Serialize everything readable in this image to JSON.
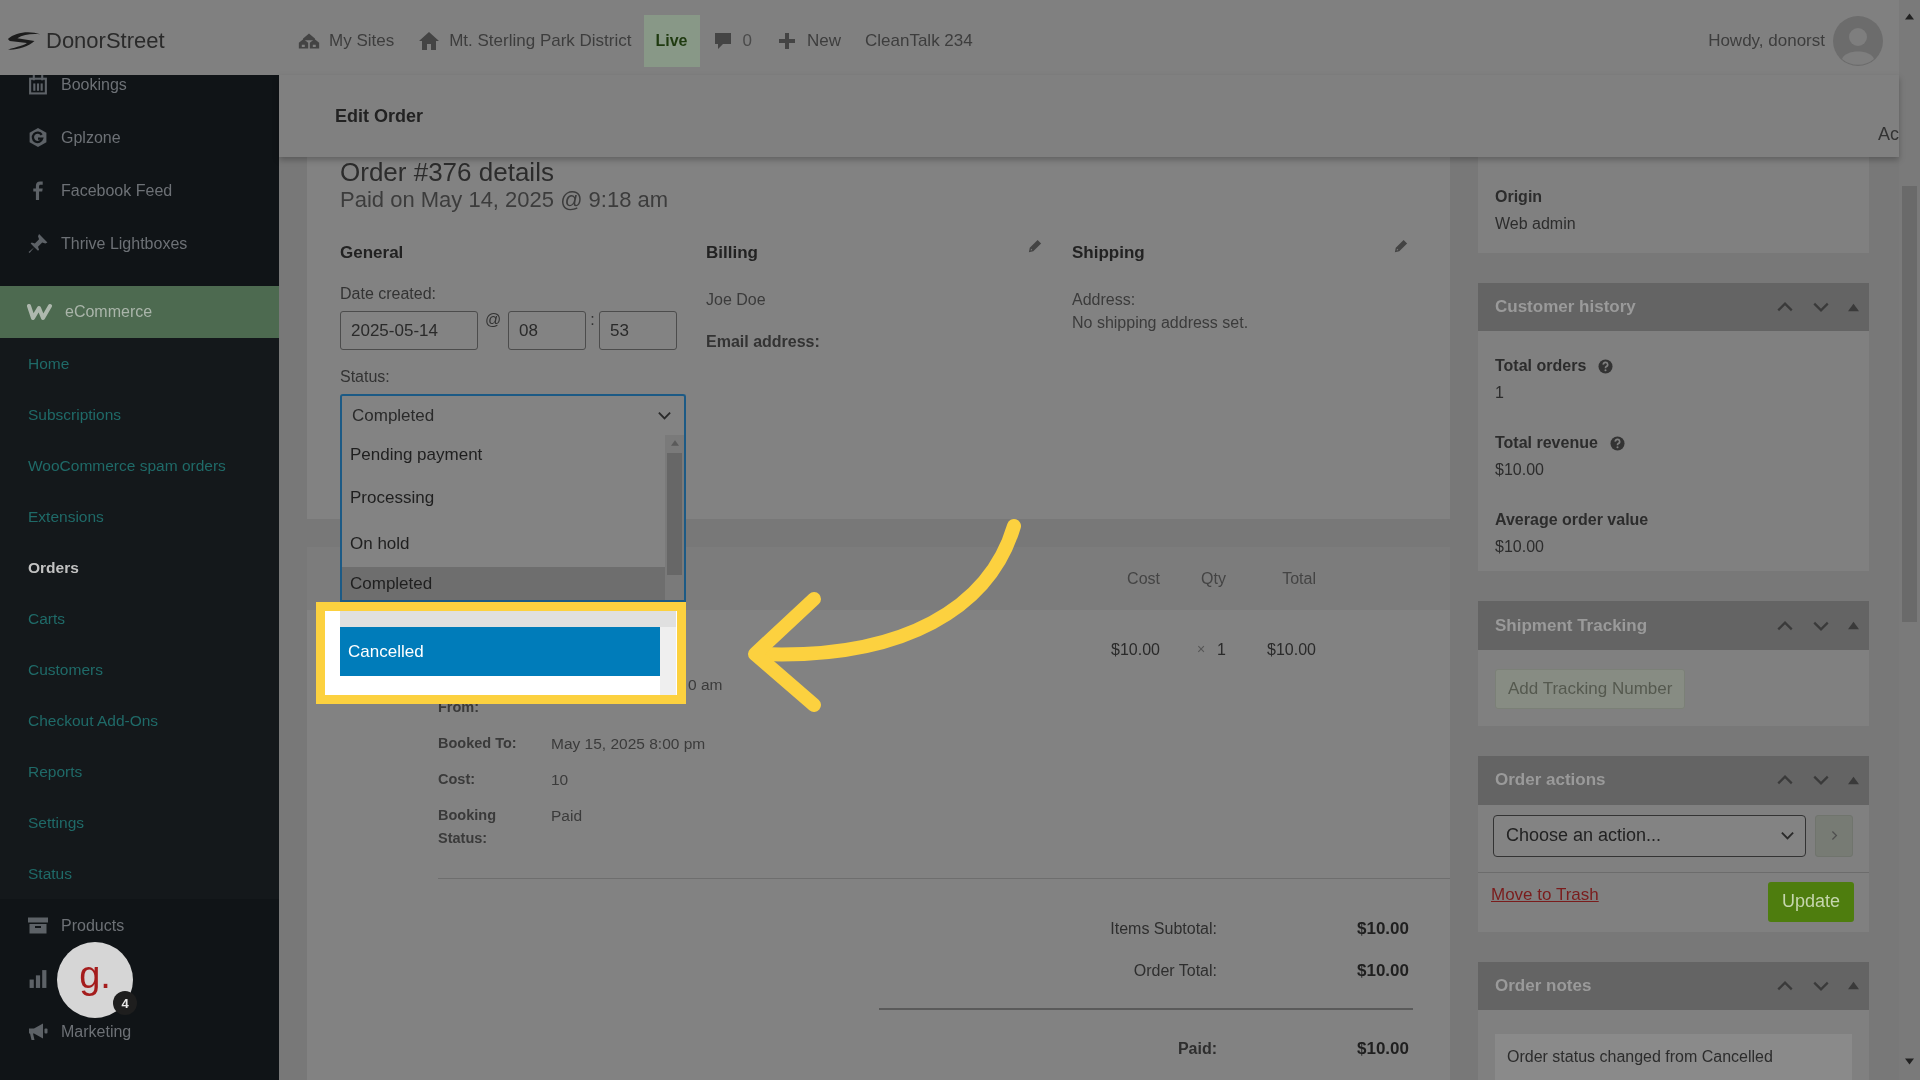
{
  "topbar": {
    "logo": "DonorStreet",
    "items": [
      {
        "kind": "sites",
        "label": "My Sites"
      },
      {
        "kind": "home",
        "label": "Mt. Sterling Park District"
      },
      {
        "kind": "badge",
        "label": "Live"
      },
      {
        "kind": "comments",
        "label": "0"
      },
      {
        "kind": "new",
        "label": "New"
      },
      {
        "kind": "plain",
        "label": "CleanTalk 234"
      }
    ],
    "greeting": "Howdy, donorst"
  },
  "sidebar": {
    "items": [
      {
        "kind": "calendar",
        "label": "Bookings",
        "selected": false
      },
      {
        "kind": "hexagon",
        "label": "Gplzone",
        "selected": false
      },
      {
        "kind": "facebook",
        "label": "Facebook Feed",
        "selected": false
      },
      {
        "kind": "pin",
        "label": "Thrive Lightboxes",
        "selected": false
      }
    ],
    "current": {
      "kind": "woo",
      "label": "eCommerce",
      "selected": true
    },
    "submenu": [
      {
        "label": "Home",
        "selected": false
      },
      {
        "label": "Subscriptions",
        "selected": false
      },
      {
        "label": "WooCommerce spam orders",
        "selected": false
      },
      {
        "label": "Extensions",
        "selected": false
      },
      {
        "label": "Orders",
        "selected": true
      },
      {
        "label": "Carts",
        "selected": false
      },
      {
        "label": "Customers",
        "selected": false
      },
      {
        "label": "Checkout Add-Ons",
        "selected": false
      },
      {
        "label": "Reports",
        "selected": false
      },
      {
        "label": "Settings",
        "selected": false
      },
      {
        "label": "Status",
        "selected": false
      }
    ],
    "more": [
      {
        "kind": "archive",
        "label": "Products",
        "selected": false
      },
      {
        "kind": "chart",
        "selected": false
      },
      {
        "kind": "megaphone",
        "label": "Marketing",
        "selected": false
      }
    ]
  },
  "chat_badge": {
    "letter": "g.",
    "count": "4"
  },
  "header": {
    "title": "Edit Order",
    "edge_text": "Ac"
  },
  "order": {
    "title": "Order #376 details",
    "subtitle": "Paid on May 14, 2025 @ 9:18 am",
    "general": {
      "heading": "General",
      "date_label": "Date created:",
      "date": "2025-05-14",
      "at": "@",
      "hour": "08",
      "sep": ":",
      "minute": "53",
      "status_label": "Status:",
      "status": {
        "value": "Completed",
        "expanded": true,
        "options": [
          {
            "label": "Pending payment",
            "selected": false,
            "hovered": false
          },
          {
            "label": "Processing",
            "selected": false,
            "hovered": false
          },
          {
            "label": "On hold",
            "selected": false,
            "hovered": false
          },
          {
            "label": "Completed",
            "selected": true,
            "hovered": false
          },
          {
            "label": "Cancelled",
            "selected": false,
            "hovered": true
          }
        ]
      }
    },
    "billing": {
      "heading": "Billing",
      "name": "Joe Doe",
      "email_label": "Email address:"
    },
    "shipping": {
      "heading": "Shipping",
      "address_label": "Address:",
      "address": "No shipping address set."
    }
  },
  "items": {
    "columns": [
      "Cost",
      "Qty",
      "Total"
    ],
    "row": {
      "cost": "$10.00",
      "times": "×",
      "qty": "1",
      "total": "$10.00"
    },
    "meta": [
      {
        "kind": "clipped",
        "label": "From:",
        "value": "0 am"
      },
      {
        "kind": "plain",
        "label": "Booked To:",
        "value": "May 15, 2025 8:00 pm"
      },
      {
        "kind": "plain",
        "label": "Cost:",
        "value": "10"
      },
      {
        "kind": "plain",
        "label": "Booking Status:",
        "value": "Paid"
      }
    ]
  },
  "totals": [
    {
      "kind": "plain",
      "label": "Items Subtotal:",
      "value": "$10.00"
    },
    {
      "kind": "plain",
      "label": "Order Total:",
      "value": "$10.00"
    },
    {
      "kind": "paid",
      "label": "Paid:",
      "value": "$10.00"
    }
  ],
  "side": {
    "origin": {
      "label": "Origin",
      "value": "Web admin"
    },
    "history": {
      "title": "Customer history",
      "stats": [
        {
          "label": "Total orders",
          "help": true,
          "value": "1"
        },
        {
          "label": "Total revenue",
          "help": true,
          "value": "$10.00"
        },
        {
          "label": "Average order value",
          "value": "$10.00"
        }
      ]
    },
    "tracking": {
      "title": "Shipment Tracking",
      "button": "Add Tracking Number"
    },
    "actions": {
      "title": "Order actions",
      "select": "Choose an action...",
      "trash": "Move to Trash",
      "update": "Update"
    },
    "notes": {
      "title": "Order notes",
      "notes": [
        "Order status changed from Cancelled"
      ]
    }
  }
}
